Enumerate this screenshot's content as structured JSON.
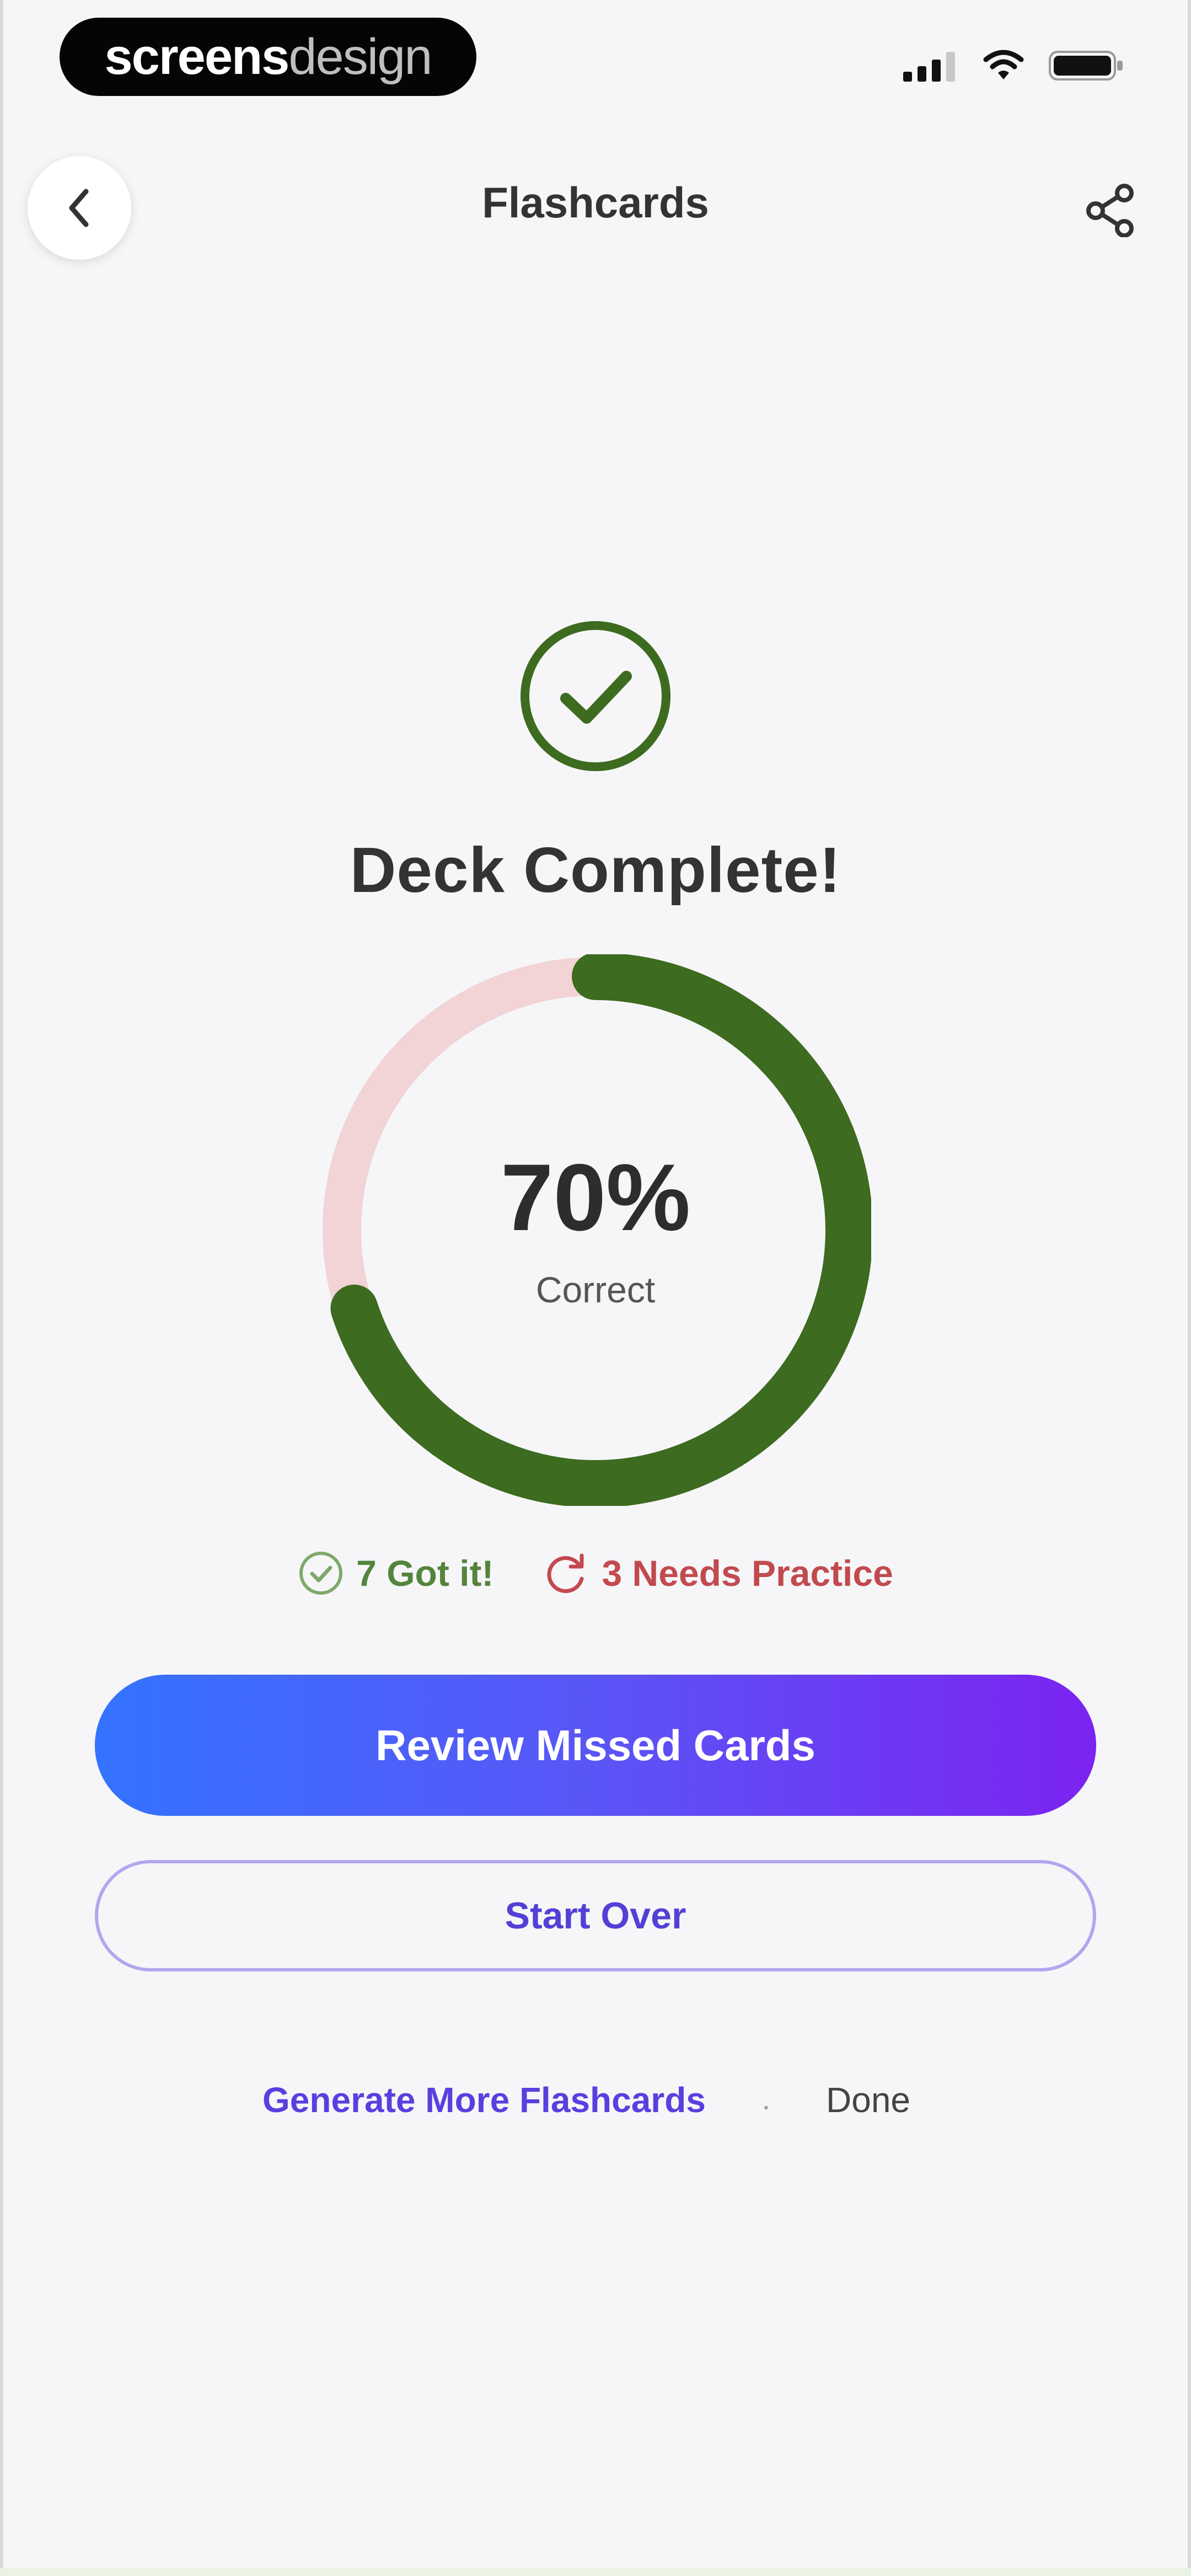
{
  "status_bar": {
    "brand_bold": "screens",
    "brand_light": "design",
    "icons": [
      "cellular-signal-icon",
      "wifi-icon",
      "battery-icon"
    ]
  },
  "nav": {
    "back_icon": "chevron-left-icon",
    "title": "Flashcards",
    "share_icon": "share-icon"
  },
  "result": {
    "icon": "check-circle-icon",
    "title": "Deck Complete!",
    "percent": "70%",
    "percent_value": 0.7,
    "percent_caption": "Correct",
    "got_it": "7 Got it!",
    "needs_practice": "3 Needs Practice"
  },
  "actions": {
    "review_label": "Review Missed Cards",
    "start_over_label": "Start Over",
    "generate_label": "Generate More Flashcards",
    "separator": "·",
    "done_label": "Done"
  },
  "colors": {
    "success": "#3d6b1f",
    "ring_track": "#f2d4d6",
    "needs_practice": "#c24a4f",
    "gradient_start": "#3473ff",
    "gradient_end": "#7c23f1",
    "accent": "#5a3fe0"
  }
}
